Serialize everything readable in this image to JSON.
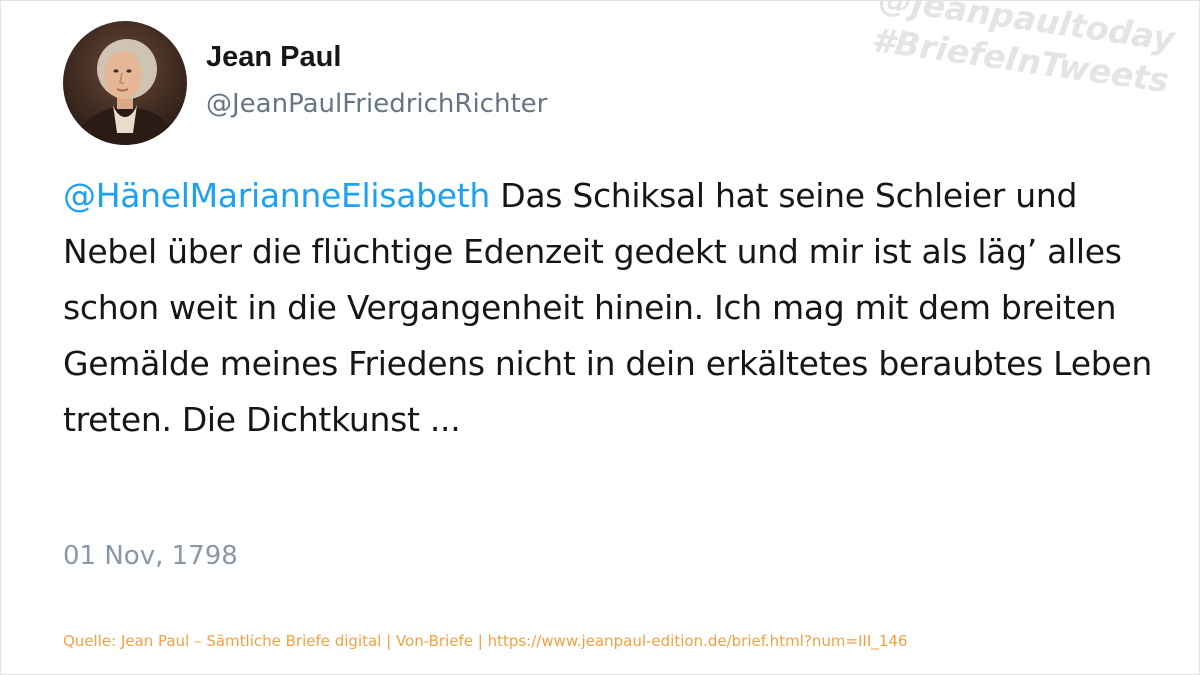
{
  "author": {
    "display_name": "Jean Paul",
    "handle": "@JeanPaulFriedrichRichter"
  },
  "watermark": {
    "line1": "@jeanpaultoday",
    "line2": "#BriefeInTweets"
  },
  "tweet": {
    "mention": "@HänelMarianneElisabeth",
    "body": " Das Schiksal hat seine Schleier und Nebel über die flüchtige Edenzeit gedekt und mir ist als läg’ alles schon weit in die Vergangenheit hinein. Ich mag mit dem breiten Gemälde meines Friedens nicht in dein erkältetes beraubtes Leben treten. Die Dichtkunst ...",
    "date": "01 Nov, 1798"
  },
  "source": "Quelle: Jean Paul – Sämtliche Briefe digital | Von-Briefe | https://www.jeanpaul-edition.de/brief.html?num=III_146",
  "colors": {
    "mention": "#1da1f2",
    "text": "#14171a",
    "muted": "#657786",
    "source": "#f5a040",
    "watermark": "#e4e4e4"
  },
  "icons": {
    "avatar": "portrait-avatar"
  }
}
